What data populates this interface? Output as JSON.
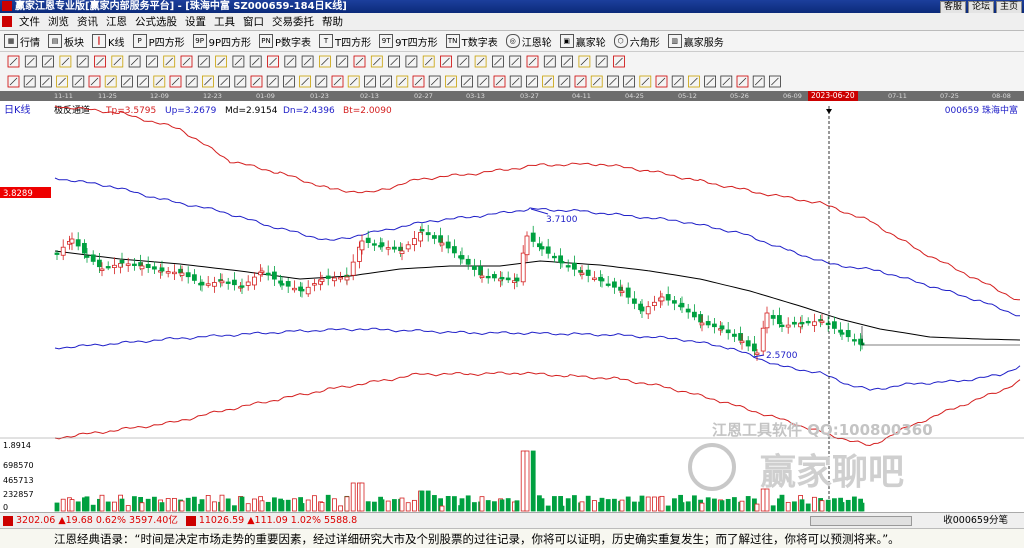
{
  "window": {
    "title": "赢家江恩专业版[赢家内部服务平台] - [珠海中富  SZ000659-184日K线]",
    "buttons": [
      "客服",
      "论坛",
      "主页"
    ]
  },
  "menu": [
    "文件",
    "浏览",
    "资讯",
    "江恩",
    "公式选股",
    "设置",
    "工具",
    "窗口",
    "交易委托",
    "帮助"
  ],
  "toolbar1": [
    "行情",
    "板块",
    "K线",
    "P四方形",
    "9P四方形",
    "P数字表",
    "T四方形",
    "9T四方形",
    "T数字表",
    "江恩轮",
    "赢家轮",
    "六角形",
    "赢家服务"
  ],
  "date_axis": {
    "labels": [
      "11-11",
      "11-25",
      "12-09",
      "12-23",
      "01-09",
      "01-23",
      "02-13",
      "02-27",
      "03-13",
      "03-27",
      "04-11",
      "04-25",
      "05-12",
      "05-26",
      "06-09",
      "07-11",
      "07-25",
      "08-08"
    ],
    "highlight": "2023-06-20"
  },
  "chart_header": {
    "period": "日K线",
    "indicator": "极反通道",
    "tp": "Tp=3.5795",
    "up": "Up=3.2679",
    "md": "Md=2.9154",
    "dn": "Dn=2.4396",
    "bt": "Bt=2.0090",
    "symbol": "000659  珠海中富"
  },
  "price_marker": "3.8289",
  "annotations": {
    "high": "3.7100",
    "low": "2.5700"
  },
  "volume_axis": [
    "1.8914",
    "698570",
    "465713",
    "232857",
    "0"
  ],
  "watermark": {
    "line1": "江恩工具软件   QQ:100800360",
    "brand": "赢家聊吧"
  },
  "statusbar": {
    "idx1": "3202.06",
    "idx1_chg": "▲19.68 0.62% 3597.40亿",
    "idx2": "11026.59",
    "idx2_chg": "▲111.09 1.02% 5588.8",
    "right": "收000659分笔"
  },
  "ticker": "江恩经典语录：“时间是决定市场走势的重要因素，经过详细研究大市及个别股票的过往记录，你将可以证明，历史确实重复发生；而了解过往，你将可以预测将来。”。",
  "colors": {
    "upper_band": "#d42020",
    "mid_band": "#2020c8",
    "center_line": "#000000",
    "up_candle": "#d42020",
    "down_candle": "#00a040"
  },
  "chart_data": {
    "type": "candlestick",
    "candles": [],
    "series": []
  }
}
